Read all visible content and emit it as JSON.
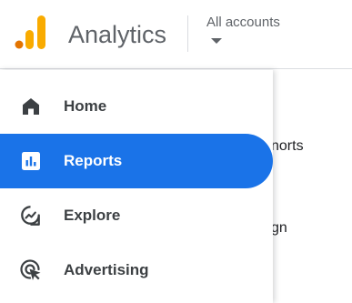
{
  "header": {
    "title": "Analytics",
    "account_switcher": {
      "label": "All accounts"
    }
  },
  "background": {
    "partial_texts": [
      "norts",
      "gn"
    ]
  },
  "nav": {
    "items": [
      {
        "label": "Home",
        "icon": "home-icon"
      },
      {
        "label": "Reports",
        "icon": "reports-icon",
        "active": true
      },
      {
        "label": "Explore",
        "icon": "explore-icon"
      },
      {
        "label": "Advertising",
        "icon": "advertising-icon"
      }
    ]
  },
  "colors": {
    "accent": "#1a73e8",
    "logo_orange": "#f9ab00",
    "logo_dark_orange": "#e37400",
    "text_primary": "#202124",
    "text_secondary": "#5f6368",
    "icon": "#3c4043"
  }
}
